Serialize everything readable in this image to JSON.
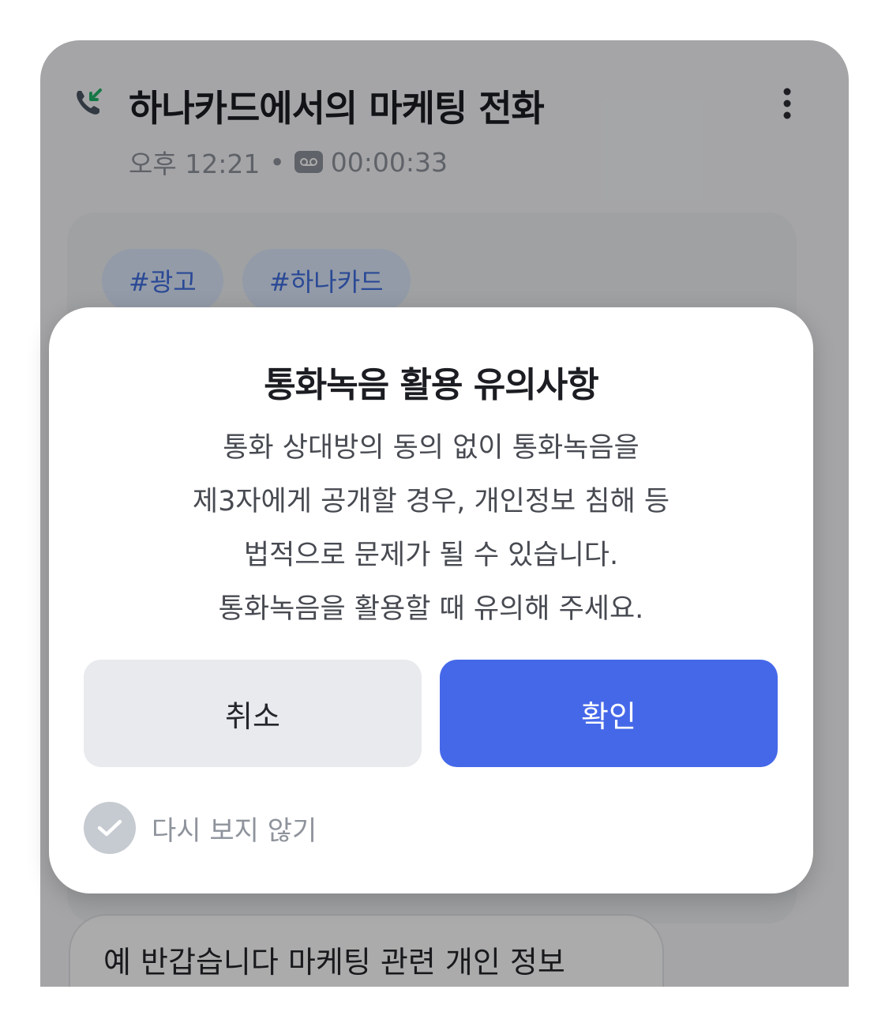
{
  "header": {
    "title": "하나카드에서의 마케팅 전화",
    "time": "오후 12:21",
    "separator": "•",
    "duration": "00:00:33"
  },
  "tags": [
    "#광고",
    "#하나카드"
  ],
  "transcript": {
    "first_line": "예 반갑습니다 마케팅 관련 개인 정보"
  },
  "modal": {
    "title": "통화녹음 활용 유의사항",
    "body_lines": [
      "통화 상대방의 동의 없이 통화녹음을",
      "제3자에게 공개할 경우, 개인정보 침해 등",
      "법적으로 문제가 될 수 있습니다.",
      "통화녹음을 활용할 때 유의해 주세요."
    ],
    "cancel_label": "취소",
    "confirm_label": "확인",
    "dont_show_label": "다시 보지 않기"
  },
  "colors": {
    "accent": "#4568e9",
    "cancel_bg": "#e8eaee",
    "incoming_call_green": "#23b36b",
    "tag_text": "#3f6ee0"
  },
  "icons": [
    "incoming-call-icon",
    "more-vertical-icon",
    "voicemail-icon",
    "check-icon"
  ]
}
